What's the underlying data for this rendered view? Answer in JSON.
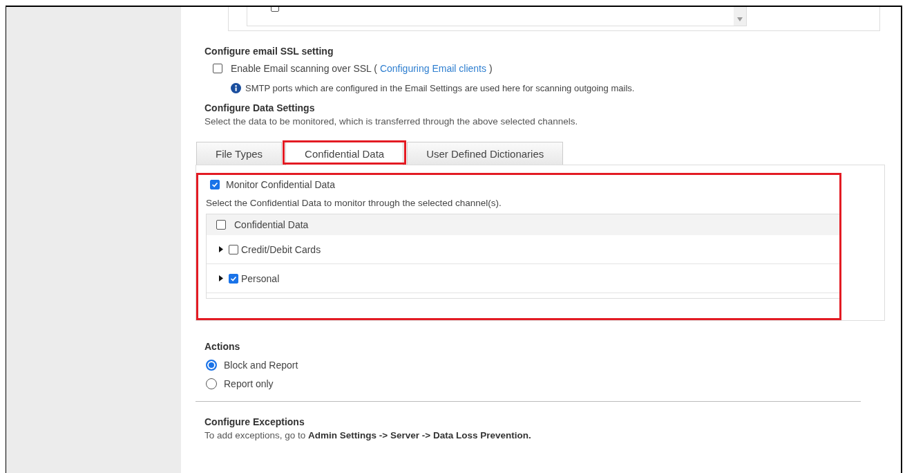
{
  "ssl_section": {
    "title": "Configure email SSL setting",
    "option": {
      "label": "Enable Email scanning over SSL (",
      "link": "Configuring Email clients",
      "suffix": ")",
      "checked": false
    },
    "note": "SMTP ports which are configured in the Email Settings are used here for scanning outgoing mails."
  },
  "data_section": {
    "title": "Configure Data Settings",
    "description": "Select the data to be monitored, which is transferred through the above selected channels."
  },
  "tabs": [
    {
      "label": "File Types",
      "selected": false,
      "highlighted": false
    },
    {
      "label": "Confidential Data",
      "selected": true,
      "highlighted": true
    },
    {
      "label": "User Defined Dictionaries",
      "selected": false,
      "highlighted": false
    }
  ],
  "panel": {
    "highlighted": true,
    "monitor": {
      "label": "Monitor Confidential Data",
      "checked": true
    },
    "hint": "Select the Confidential Data to monitor through the selected channel(s).",
    "tree": {
      "header": {
        "label": "Confidential Data",
        "checked": false
      },
      "items": [
        {
          "label": "Credit/Debit Cards",
          "checked": false,
          "expanded": false
        },
        {
          "label": "Personal",
          "checked": true,
          "expanded": false
        }
      ]
    }
  },
  "actions": {
    "title": "Actions",
    "options": [
      {
        "label": "Block and Report",
        "selected": true
      },
      {
        "label": "Report only",
        "selected": false
      }
    ]
  },
  "exceptions": {
    "title": "Configure Exceptions",
    "text": "To add exceptions, go to **Admin Settings -> Server -> Data Loss Prevention.**"
  }
}
